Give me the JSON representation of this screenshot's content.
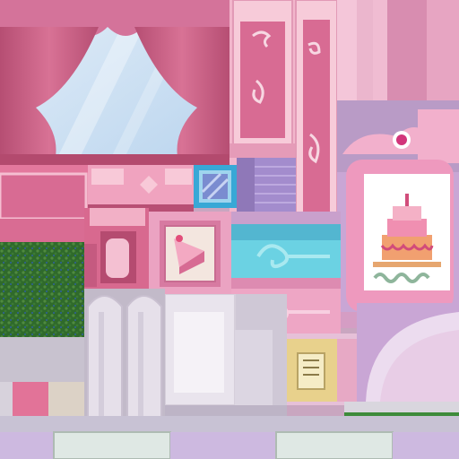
{
  "texture_atlas": {
    "tiles": [
      {
        "id": "window-curtains",
        "kind": "window",
        "icon": "curtained-window-icon"
      },
      {
        "id": "pink-pillar",
        "kind": "pillar",
        "icon": "ornate-pillar-icon"
      },
      {
        "id": "wall-panel-strip",
        "kind": "panel"
      },
      {
        "id": "blue-window",
        "kind": "window",
        "icon": "small-window-icon"
      },
      {
        "id": "stairs",
        "kind": "stairs",
        "icon": "stairs-icon"
      },
      {
        "id": "cake-poster-frame",
        "kind": "frame",
        "icon": "cake-icon"
      },
      {
        "id": "cake-painting",
        "kind": "painting",
        "icon": "cake-slice-icon"
      },
      {
        "id": "shelf-cabinet",
        "kind": "shelf"
      },
      {
        "id": "grass",
        "kind": "ground",
        "icon": "grass-icon"
      },
      {
        "id": "arched-columns",
        "kind": "columns"
      },
      {
        "id": "white-panel",
        "kind": "panel"
      },
      {
        "id": "wall-switch",
        "kind": "device",
        "icon": "control-panel-icon"
      },
      {
        "id": "round-table",
        "kind": "furniture"
      },
      {
        "id": "floor-tiles",
        "kind": "floor"
      }
    ],
    "palette": {
      "pink_main": "#d86b93",
      "pink_light": "#f4b8cf",
      "lavender": "#c8a8d8",
      "white": "#eeeaf0",
      "sky": "#cfe4f3",
      "teal": "#6ad6e3",
      "green": "#3a6e35"
    }
  }
}
